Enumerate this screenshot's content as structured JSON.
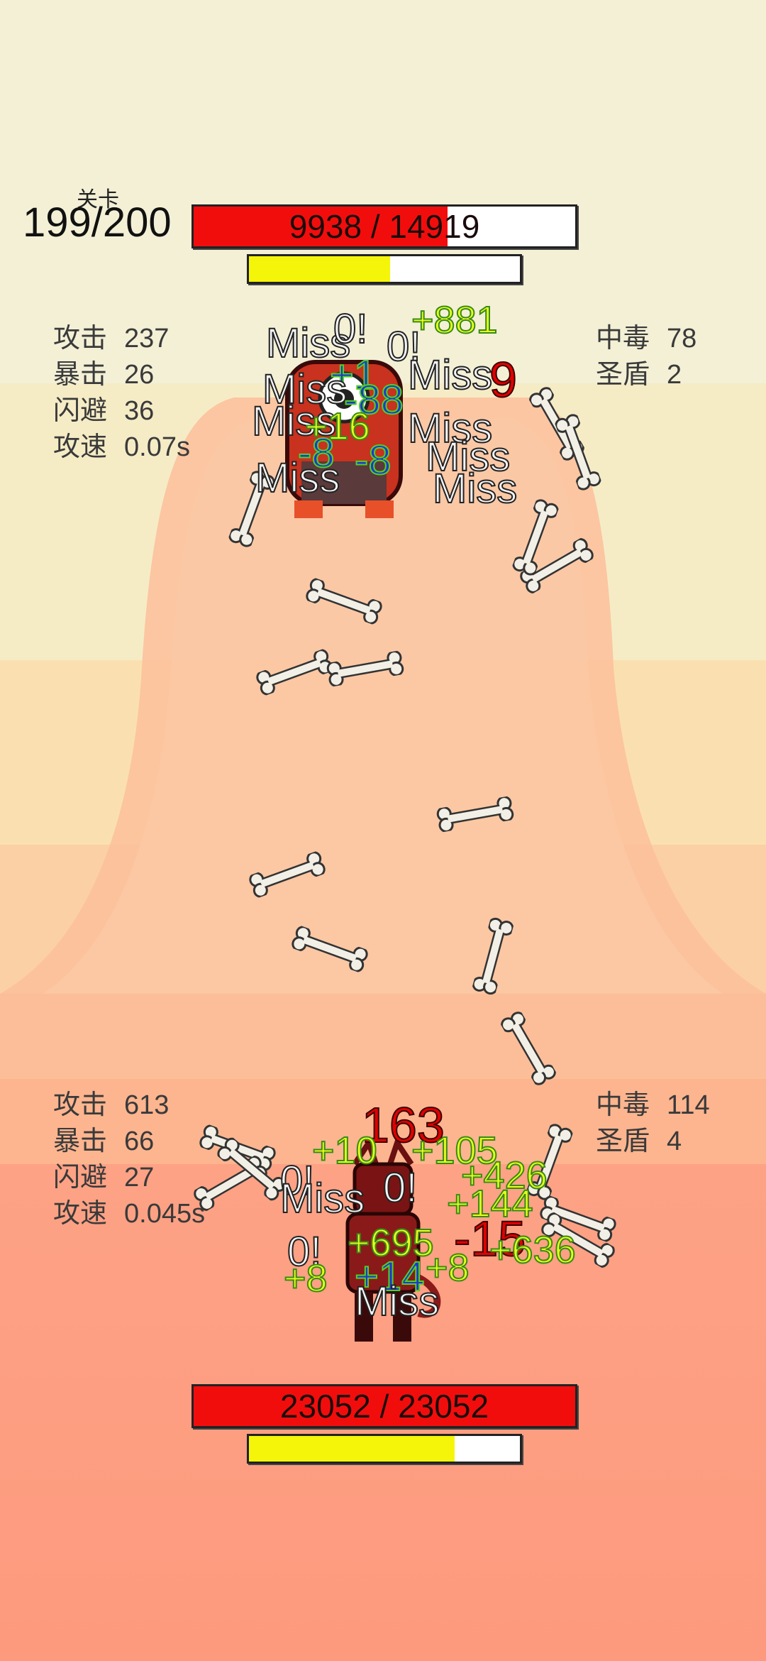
{
  "stage": {
    "label": "关卡",
    "value": "199/200"
  },
  "enemy": {
    "hp_text": "9938 / 14919",
    "hp_fraction": 0.666,
    "energy_fraction": 0.52,
    "stats_left": [
      {
        "k": "攻击",
        "v": "237"
      },
      {
        "k": "暴击",
        "v": "26"
      },
      {
        "k": "闪避",
        "v": "36"
      },
      {
        "k": "攻速",
        "v": "0.07s"
      }
    ],
    "stats_right": [
      {
        "k": "中毒",
        "v": "78"
      },
      {
        "k": "圣盾",
        "v": "2"
      }
    ],
    "popups": [
      {
        "t": "Miss",
        "c": "miss"
      },
      {
        "t": "0!",
        "c": "miss"
      },
      {
        "t": "0!",
        "c": "miss"
      },
      {
        "t": "+881",
        "c": "heal"
      },
      {
        "t": "+1",
        "c": "poison"
      },
      {
        "t": "Miss",
        "c": "miss"
      },
      {
        "t": "9",
        "c": "dmg"
      },
      {
        "t": "Miss",
        "c": "miss"
      },
      {
        "t": "-88",
        "c": "poison"
      },
      {
        "t": "Miss",
        "c": "miss"
      },
      {
        "t": "+16",
        "c": "heal"
      },
      {
        "t": "Miss",
        "c": "miss"
      },
      {
        "t": "-8",
        "c": "poison"
      },
      {
        "t": "-8",
        "c": "poison"
      },
      {
        "t": "Miss",
        "c": "miss"
      },
      {
        "t": "Miss",
        "c": "miss"
      },
      {
        "t": "Miss",
        "c": "miss"
      }
    ]
  },
  "player": {
    "hp_text": "23052 / 23052",
    "hp_fraction": 1.0,
    "energy_fraction": 0.76,
    "stats_left": [
      {
        "k": "攻击",
        "v": "613"
      },
      {
        "k": "暴击",
        "v": "66"
      },
      {
        "k": "闪避",
        "v": "27"
      },
      {
        "k": "攻速",
        "v": "0.045s"
      }
    ],
    "stats_right": [
      {
        "k": "中毒",
        "v": "114"
      },
      {
        "k": "圣盾",
        "v": "4"
      }
    ],
    "popups": [
      {
        "t": "163",
        "c": "dmg"
      },
      {
        "t": "+10",
        "c": "heal"
      },
      {
        "t": "+105",
        "c": "heal"
      },
      {
        "t": "0!",
        "c": "miss"
      },
      {
        "t": "Miss",
        "c": "miss"
      },
      {
        "t": "0!",
        "c": "miss"
      },
      {
        "t": "+426",
        "c": "heal"
      },
      {
        "t": "+144",
        "c": "heal"
      },
      {
        "t": "-15",
        "c": "dmg"
      },
      {
        "t": "+695",
        "c": "heal"
      },
      {
        "t": "0!",
        "c": "miss"
      },
      {
        "t": "+8",
        "c": "heal"
      },
      {
        "t": "+8",
        "c": "heal"
      },
      {
        "t": "+14",
        "c": "poison"
      },
      {
        "t": "+636",
        "c": "heal"
      },
      {
        "t": "Miss",
        "c": "miss"
      }
    ]
  },
  "colors": {
    "hp_fill": "#f20d0d",
    "energy_fill": "#f5f50a",
    "mound": "#fbbf9a"
  }
}
